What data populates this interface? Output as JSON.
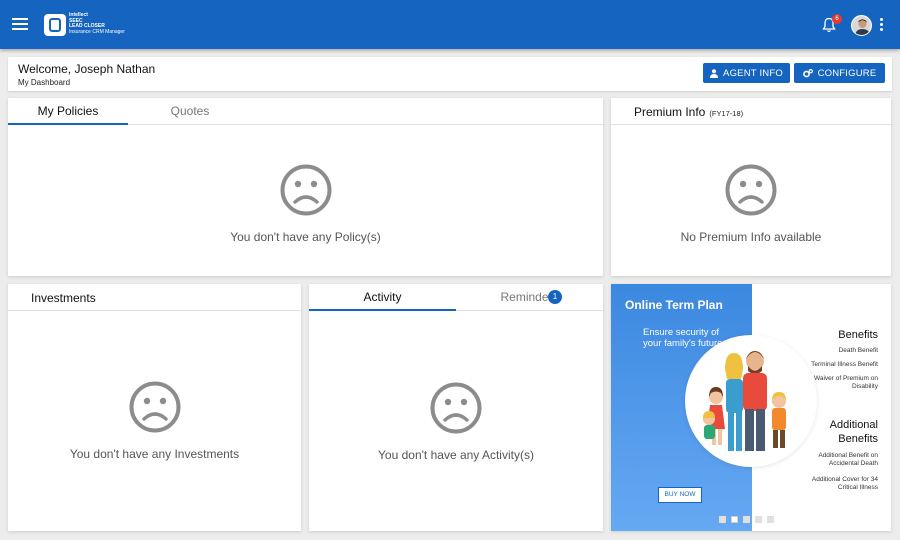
{
  "app": {
    "logo_lines": [
      "intellect",
      "SEEC",
      "LEAD CLOSER",
      "Insurance CRM Manager"
    ],
    "notification_count": "6",
    "accent": "#1565c0"
  },
  "header": {
    "welcome": "Welcome, Joseph Nathan",
    "subtitle": "My Dashboard",
    "agent_info_label": "AGENT INFO",
    "configure_label": "CONFIGURE"
  },
  "policies": {
    "tabs": [
      {
        "label": "My Policies",
        "active": true
      },
      {
        "label": "Quotes",
        "active": false
      }
    ],
    "empty_message": "You don't have any Policy(s)"
  },
  "premium": {
    "title": "Premium Info",
    "period": "(FY17-18)",
    "empty_message": "No Premium Info available"
  },
  "investments": {
    "title": "Investments",
    "empty_message": "You don't have any Investments"
  },
  "activity": {
    "tabs": [
      {
        "label": "Activity",
        "active": true
      },
      {
        "label": "Reminders",
        "active": false
      }
    ],
    "reminders_count": "1",
    "empty_message": "You don't have any Activity(s)"
  },
  "promo": {
    "title": "Online Term Plan",
    "description": "Ensure security of your family's future.",
    "buy_label": "BUY NOW",
    "benefits_title": "Benefits",
    "benefits": [
      "Death Benefit",
      "Terminal Illness Benefit",
      "Waiver of Premium on Disability"
    ],
    "additional_title": "Additional Benefits",
    "additional": [
      "Additional Benefit on Accidental Death",
      "Additional Cover for 34 Critical Illness"
    ],
    "slide_count": 5,
    "active_slide": 2
  }
}
